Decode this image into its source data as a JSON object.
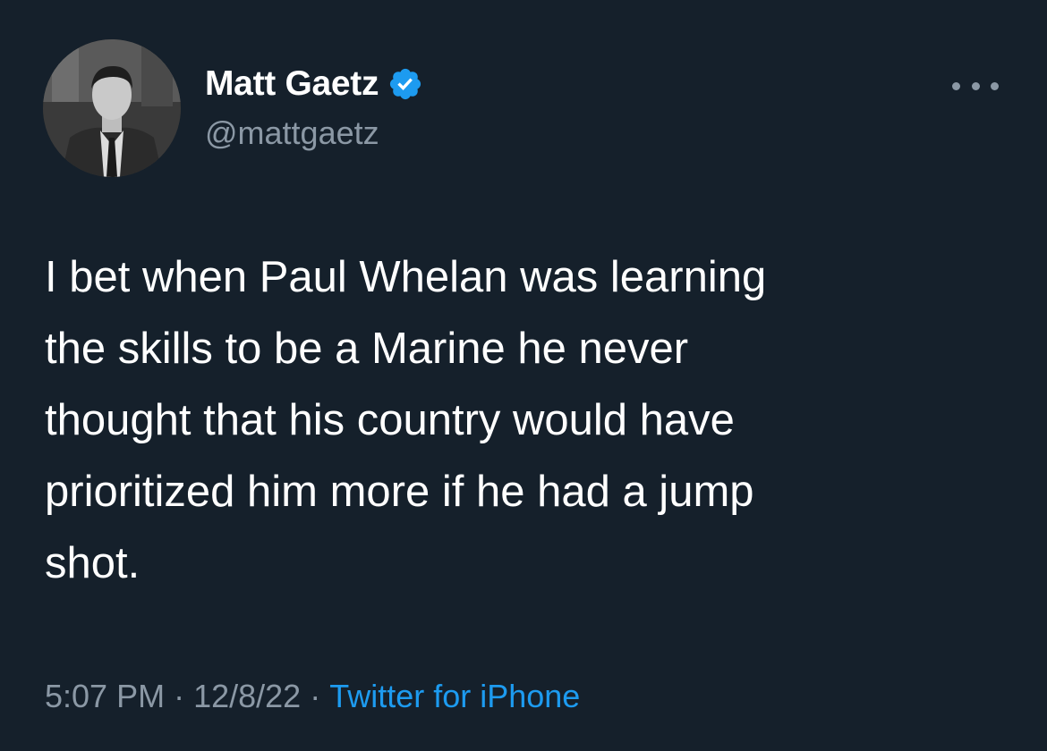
{
  "author": {
    "name": "Matt Gaetz",
    "handle": "@mattgaetz",
    "verified_icon": "verified-badge-icon",
    "verified_color": "#1d9bf0"
  },
  "menu": {
    "icon": "more-options-icon"
  },
  "tweet": {
    "text": "I bet when Paul Whelan was learning\nthe skills to be a Marine he never\nthought that his country would have\nprioritized him more if he had a jump\nshot."
  },
  "meta": {
    "time": "5:07 PM",
    "separator": "·",
    "date": "12/8/22",
    "source": "Twitter for iPhone"
  },
  "colors": {
    "background": "#15202b",
    "text": "#ffffff",
    "secondary": "#8b98a5",
    "link": "#1d9bf0"
  }
}
